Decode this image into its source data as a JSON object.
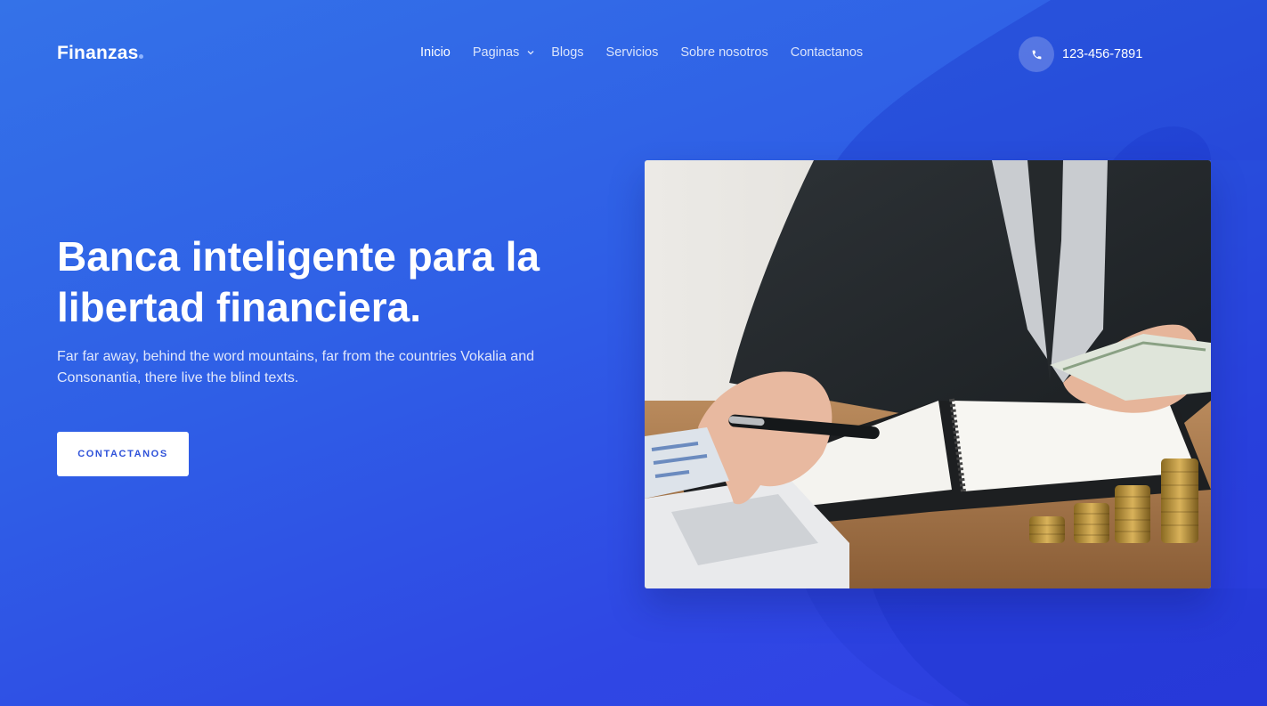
{
  "brand": {
    "name": "Finanzas"
  },
  "nav": {
    "items": [
      {
        "label": "Inicio",
        "active": true
      },
      {
        "label": "Paginas",
        "dropdown": true
      },
      {
        "label": "Blogs"
      },
      {
        "label": "Servicios"
      },
      {
        "label": "Sobre nosotros"
      },
      {
        "label": "Contactanos"
      }
    ]
  },
  "contact": {
    "phone": "123-456-7891",
    "icon": "phone-icon"
  },
  "hero": {
    "title": "Banca inteligente para la libertad financiera.",
    "text": "Far far away, behind the word mountains, far from the countries Vokalia and Consonantia, there live the blind texts.",
    "button_label": "CONTACTANOS"
  },
  "colors": {
    "background": "#3264e8",
    "button_text": "#2f52d9",
    "white": "#ffffff"
  }
}
